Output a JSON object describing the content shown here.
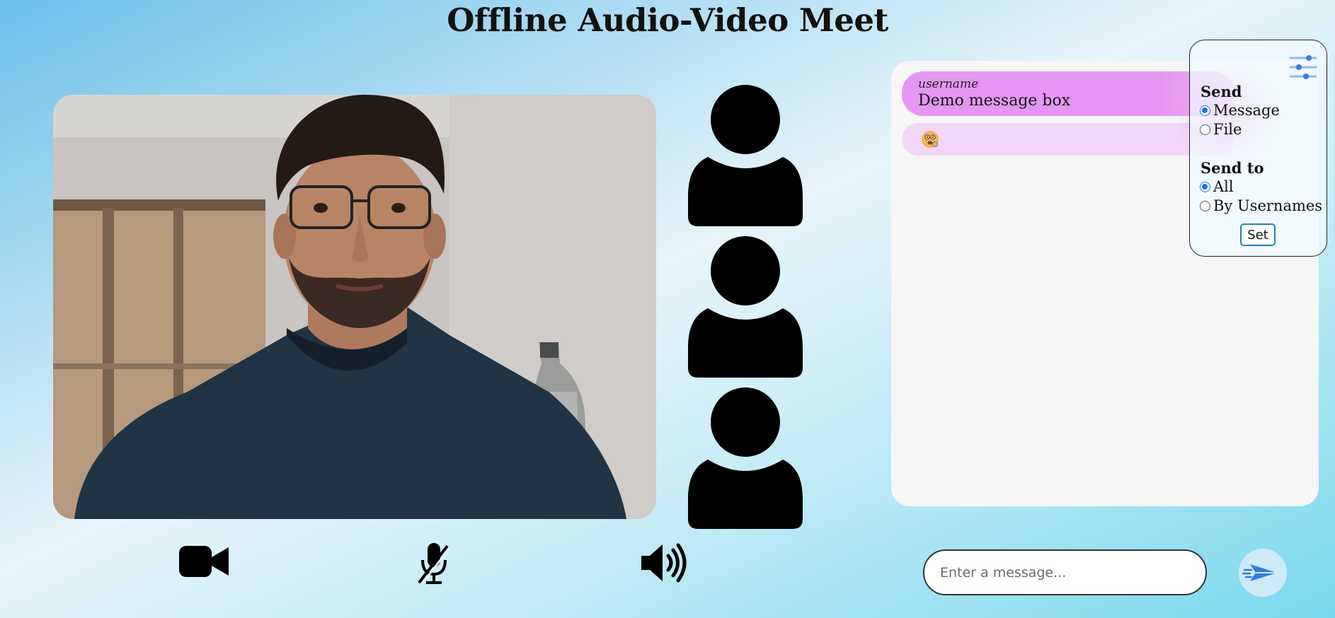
{
  "page": {
    "title": "Offline Audio-Video Meet"
  },
  "participants": [
    {
      "icon": "user-avatar-icon"
    },
    {
      "icon": "user-avatar-icon"
    },
    {
      "icon": "user-avatar-icon"
    }
  ],
  "controls": {
    "camera_icon": "video-camera-icon",
    "mic_icon": "microphone-muted-icon",
    "speaker_icon": "speaker-volume-icon"
  },
  "chat": {
    "messages": [
      {
        "username": "username",
        "text": "Demo message box"
      },
      {
        "emoji": "face-with-monocle-emoji"
      }
    ],
    "input": {
      "placeholder": "Enter a message...",
      "value": ""
    },
    "send_icon": "paper-plane-send-icon"
  },
  "settings": {
    "icon": "sliders-settings-icon",
    "send_heading": "Send",
    "send_options": [
      {
        "label": "Message",
        "checked": true
      },
      {
        "label": "File",
        "checked": false
      }
    ],
    "send_to_heading": "Send to",
    "send_to_options": [
      {
        "label": "All",
        "checked": true
      },
      {
        "label": "By Usernames",
        "checked": false
      }
    ],
    "set_label": "Set"
  },
  "colors": {
    "message_bubble": "#e596f2",
    "message_bubble_light": "#f3d7f8",
    "chat_panel": "#f6f6f6",
    "accent_blue": "#1a73e8",
    "send_button_bg": "#cfe9f8"
  }
}
